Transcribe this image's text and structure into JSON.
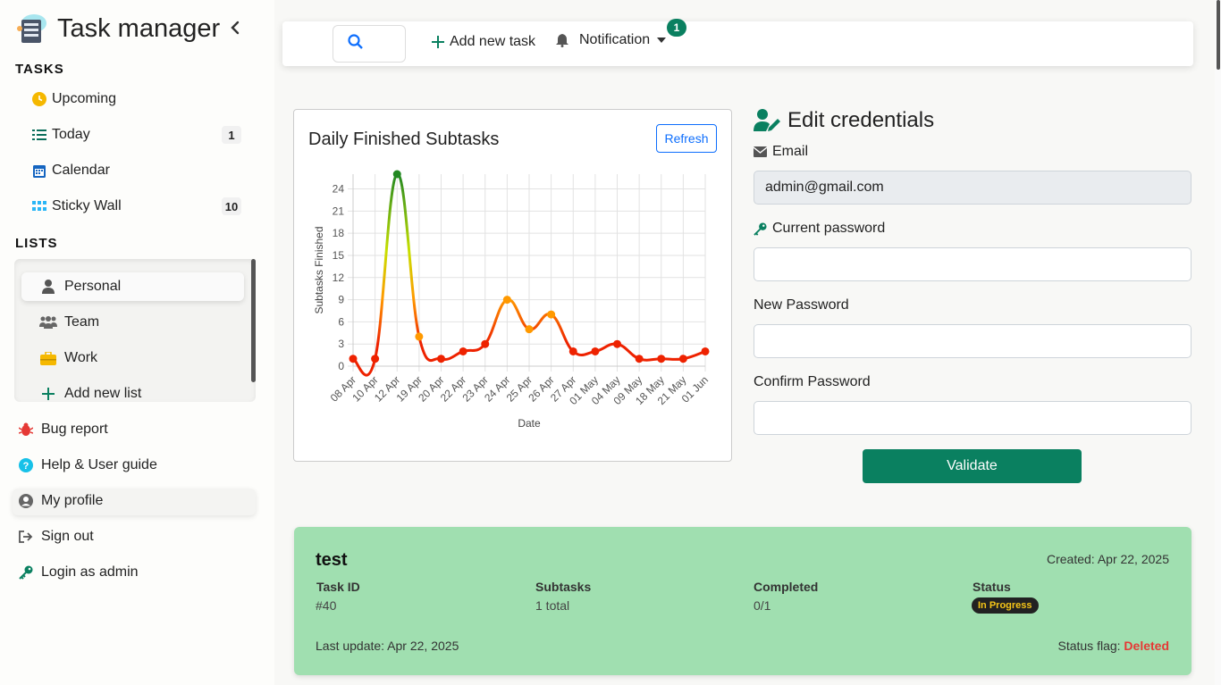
{
  "app": {
    "title": "Task manager"
  },
  "sidebar": {
    "tasks_heading": "TASKS",
    "tasks": [
      {
        "label": "Upcoming",
        "icon": "clock-icon",
        "count": ""
      },
      {
        "label": "Today",
        "icon": "list-icon",
        "count": "1"
      },
      {
        "label": "Calendar",
        "icon": "calendar-icon",
        "count": ""
      },
      {
        "label": "Sticky Wall",
        "icon": "grid-icon",
        "count": "10"
      }
    ],
    "lists_heading": "LISTS",
    "lists": [
      {
        "label": "Personal",
        "icon": "user-icon",
        "active": true
      },
      {
        "label": "Team",
        "icon": "users-icon",
        "active": false
      },
      {
        "label": "Work",
        "icon": "briefcase-icon",
        "active": false
      },
      {
        "label": "Add new list",
        "icon": "plus-icon",
        "active": false
      }
    ],
    "bottom": [
      {
        "label": "Bug report",
        "icon": "bug-icon"
      },
      {
        "label": "Help & User guide",
        "icon": "help-icon"
      },
      {
        "label": "My profile",
        "icon": "user-circle-icon"
      },
      {
        "label": "Sign out",
        "icon": "sign-out-icon"
      },
      {
        "label": "Login as admin",
        "icon": "key-icon"
      }
    ]
  },
  "topbar": {
    "add_task": "Add new task",
    "notification": "Notification",
    "notification_count": "1"
  },
  "chart_card": {
    "title": "Daily Finished Subtasks",
    "refresh": "Refresh"
  },
  "chart_data": {
    "type": "line",
    "title": "Daily Finished Subtasks",
    "xlabel": "Date",
    "ylabel": "Subtasks Finished",
    "categories": [
      "08 Apr",
      "10 Apr",
      "12 Apr",
      "19 Apr",
      "20 Apr",
      "22 Apr",
      "23 Apr",
      "24 Apr",
      "25 Apr",
      "26 Apr",
      "27 Apr",
      "01 May",
      "04 May",
      "09 May",
      "18 May",
      "21 May",
      "01 Jun"
    ],
    "values": [
      1,
      1,
      26,
      4,
      1,
      2,
      3,
      9,
      5,
      7,
      2,
      2,
      3,
      1,
      1,
      1,
      2
    ],
    "yticks": [
      0,
      3,
      6,
      9,
      12,
      15,
      18,
      21,
      24
    ],
    "ylim": [
      0,
      26
    ],
    "grid": true,
    "colors": {
      "low": "#ee2200",
      "mid": "#ff9900",
      "high": "#228822"
    }
  },
  "credentials": {
    "title": "Edit credentials",
    "email_label": "Email",
    "email_value": "admin@gmail.com",
    "current_password_label": "Current password",
    "new_password_label": "New Password",
    "confirm_password_label": "Confirm Password",
    "validate": "Validate"
  },
  "task": {
    "name": "test",
    "created": "Created: Apr 22, 2025",
    "columns": [
      {
        "header": "Task ID",
        "value": "#40"
      },
      {
        "header": "Subtasks",
        "value": "1 total"
      },
      {
        "header": "Completed",
        "value": "0/1"
      },
      {
        "header": "Status",
        "value": "In Progress"
      }
    ],
    "last_update": "Last update: Apr 22, 2025",
    "status_flag_label": "Status flag: ",
    "status_flag_value": "Deleted"
  },
  "colors": {
    "accent": "#0a8060",
    "task_card": "#a0dfb0",
    "link": "#0d6efd"
  }
}
